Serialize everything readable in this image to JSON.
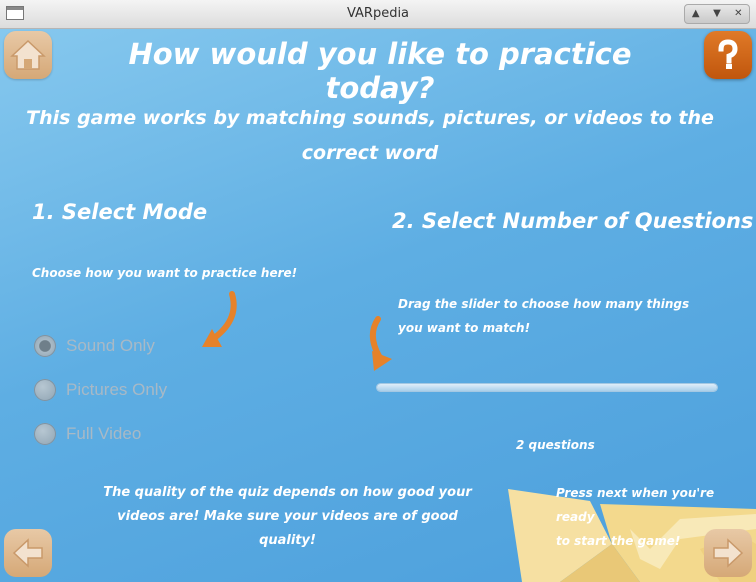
{
  "window": {
    "title": "VARpedia",
    "controls": [
      "up-icon",
      "down-icon",
      "close-icon"
    ]
  },
  "header": {
    "title": "How would you like to practice today?",
    "subtitle": "This game works by matching sounds, pictures, or videos to the correct word"
  },
  "mode_section": {
    "heading": "1. Select Mode",
    "hint": "Choose how you want to practice here!",
    "options": [
      {
        "label": "Sound Only",
        "selected": true
      },
      {
        "label": "Pictures Only",
        "selected": false
      },
      {
        "label": "Full Video",
        "selected": false
      }
    ]
  },
  "questions_section": {
    "heading": "2. Select Number of Questions",
    "hint_line1": "Drag the slider to choose how many things",
    "hint_line2": "you want to match!",
    "count_label": "2 questions"
  },
  "footer": {
    "quality_line1": "The quality of the quiz depends on how good your",
    "quality_line2": "videos are! Make sure your videos are of good quality!",
    "next_line1": "Press next when you're ready",
    "next_line2": "to start the game!"
  },
  "icons": {
    "home": "home-icon",
    "help": "question-icon",
    "back": "back-arrow-icon",
    "next": "next-arrow-icon",
    "arrow": "curved-arrow-icon",
    "boat": "paper-boat-icon"
  },
  "colors": {
    "accent": "#e07a28",
    "background": "#5eaee3"
  }
}
